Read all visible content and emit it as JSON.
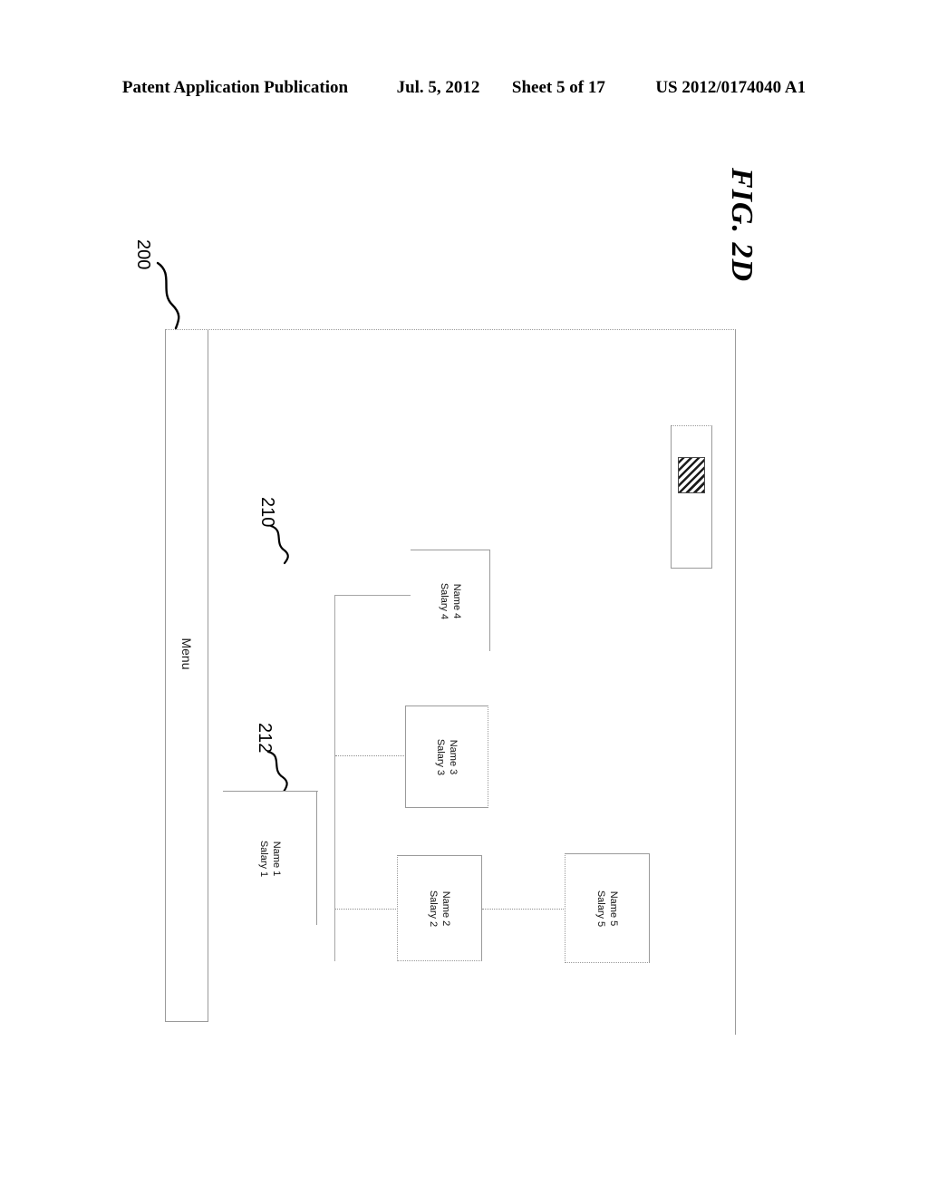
{
  "page_header": {
    "publication": "Patent Application Publication",
    "date": "Jul. 5, 2012",
    "sheet": "Sheet 5 of 17",
    "patent_number": "US 2012/0174040 A1"
  },
  "figure": {
    "label": "FIG. 2D"
  },
  "reference_numerals": [
    {
      "id": "200",
      "target": "application-window"
    },
    {
      "id": "210",
      "target": "tree-view-area"
    },
    {
      "id": "212",
      "target": "root-node"
    }
  ],
  "window": {
    "menubar": {
      "label": "Menu"
    },
    "scrollbar": {
      "name": "horizontal-scrollbar",
      "thumb_fill": "diagonal-hatch"
    },
    "tree": {
      "nodes": [
        {
          "id": "node1",
          "name": "Name 1",
          "salary": "Salary 1"
        },
        {
          "id": "node2",
          "name": "Name 2",
          "salary": "Salary 2"
        },
        {
          "id": "node3",
          "name": "Name 3",
          "salary": "Salary 3"
        },
        {
          "id": "node4",
          "name": "Name 4",
          "salary": "Salary 4"
        },
        {
          "id": "node5",
          "name": "Name 5",
          "salary": "Salary 5"
        }
      ]
    }
  },
  "colors": {
    "line": "#9a9a9a",
    "connector": "#a6a6a6",
    "text": "#111111",
    "ink": "#000000"
  }
}
